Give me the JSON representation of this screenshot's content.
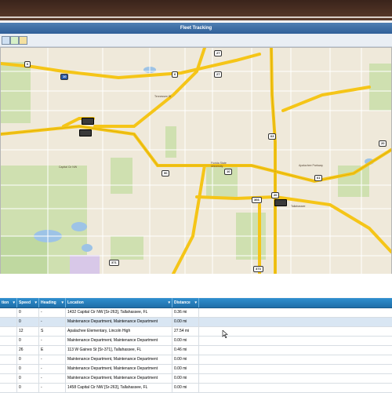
{
  "window": {
    "title": "Fleet Tracking"
  },
  "map": {
    "shields": [
      {
        "label": "6"
      },
      {
        "label": "10"
      },
      {
        "label": "27"
      },
      {
        "label": "6"
      },
      {
        "label": "27"
      },
      {
        "label": "63"
      },
      {
        "label": "10"
      },
      {
        "label": "90"
      },
      {
        "label": "20"
      },
      {
        "label": "61"
      },
      {
        "label": "366"
      },
      {
        "label": "373"
      },
      {
        "label": "371"
      },
      {
        "label": "20"
      }
    ],
    "place_labels": [
      {
        "text": "Tallahassee"
      },
      {
        "text": "Florida State University"
      },
      {
        "text": "Apalachee Parkway"
      },
      {
        "text": "Tennessee St"
      },
      {
        "text": "Capital Cir NW"
      }
    ]
  },
  "grid": {
    "columns": [
      {
        "label": "tion"
      },
      {
        "label": "Speed"
      },
      {
        "label": "Heading"
      },
      {
        "label": "Location"
      },
      {
        "label": "Distance"
      }
    ],
    "rows": [
      {
        "c0": "",
        "speed": "0",
        "heading": "-",
        "location": "1432 Capital Cir NW [Sr-263], Tallahassee, FL",
        "distance": "0.36 mi",
        "selected": false
      },
      {
        "c0": "",
        "speed": "0",
        "heading": "-",
        "location": "Maintenance Department, Maintenance Department",
        "distance": "0.00 mi",
        "selected": true
      },
      {
        "c0": "",
        "speed": "12",
        "heading": "S",
        "location": "Apalachee Elementary, Lincoln High",
        "distance": "27.54 mi",
        "selected": false
      },
      {
        "c0": "",
        "speed": "0",
        "heading": "-",
        "location": "Maintenance Department, Maintenance Department",
        "distance": "0.00 mi",
        "selected": false
      },
      {
        "c0": "",
        "speed": "26",
        "heading": "E",
        "location": "113 W Gaines St [Sr-371], Tallahassee, FL",
        "distance": "0.46 mi",
        "selected": false
      },
      {
        "c0": "",
        "speed": "0",
        "heading": "-",
        "location": "Maintenance Department, Maintenance Department",
        "distance": "0.00 mi",
        "selected": false
      },
      {
        "c0": "",
        "speed": "0",
        "heading": "-",
        "location": "Maintenance Department, Maintenance Department",
        "distance": "0.00 mi",
        "selected": false
      },
      {
        "c0": "",
        "speed": "0",
        "heading": "-",
        "location": "Maintenance Department, Maintenance Department",
        "distance": "0.00 mi",
        "selected": false
      },
      {
        "c0": "",
        "speed": "0",
        "heading": "-",
        "location": "1458 Capital Cir NW [Sr-263], Tallahassee, FL",
        "distance": "0.00 mi",
        "selected": false
      }
    ]
  }
}
